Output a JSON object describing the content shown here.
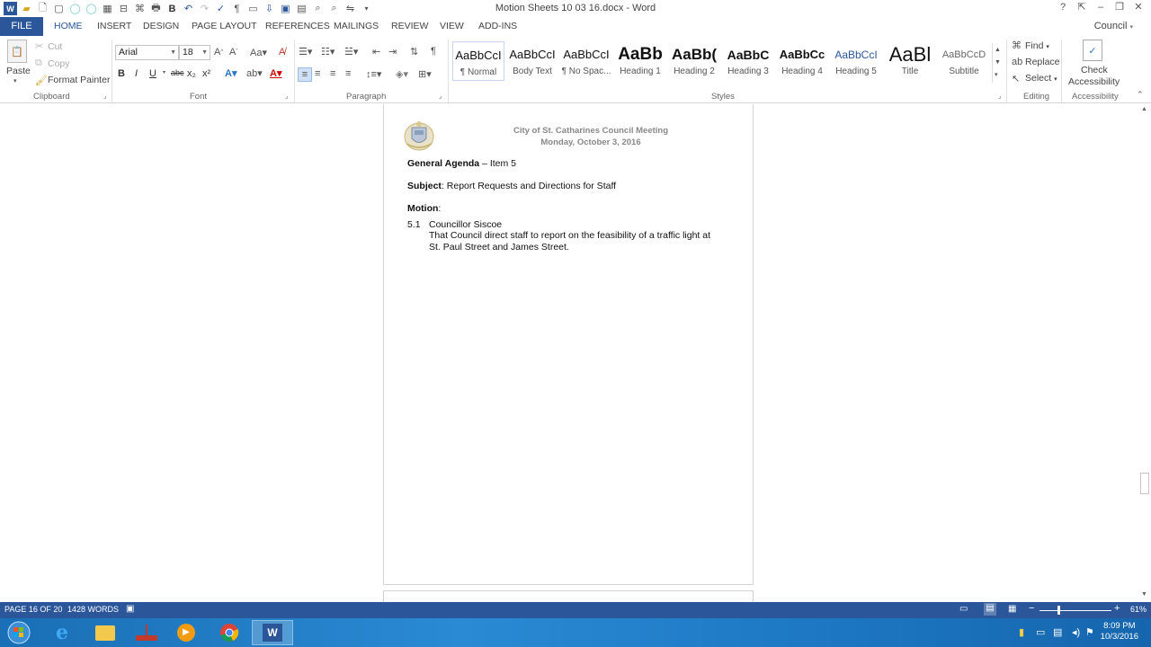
{
  "window": {
    "title": "Motion Sheets 10 03 16.docx - Word",
    "account": "Council",
    "controls": [
      "?",
      "□",
      "–",
      "❐",
      "✕"
    ]
  },
  "tabs": {
    "file": "FILE",
    "items": [
      "HOME",
      "INSERT",
      "DESIGN",
      "PAGE LAYOUT",
      "REFERENCES",
      "MAILINGS",
      "REVIEW",
      "VIEW",
      "ADD-INS"
    ],
    "active": "HOME"
  },
  "ribbon": {
    "clipboard": {
      "paste": "Paste",
      "cut": "Cut",
      "copy": "Copy",
      "format_painter": "Format Painter",
      "label": "Clipboard"
    },
    "font": {
      "family": "Arial",
      "size": "18",
      "label": "Font",
      "bold": "B",
      "italic": "I",
      "underline": "U",
      "strike": "abc",
      "subscript": "x₂",
      "superscript": "x²"
    },
    "paragraph": {
      "label": "Paragraph"
    },
    "styles": {
      "label": "Styles",
      "items": [
        {
          "sample": "AaBbCcI",
          "name": "¶ Normal"
        },
        {
          "sample": "AaBbCcI",
          "name": "Body Text"
        },
        {
          "sample": "AaBbCcI",
          "name": "¶ No Spac..."
        },
        {
          "sample": "AaBb",
          "name": "Heading 1"
        },
        {
          "sample": "AaBb(",
          "name": "Heading 2"
        },
        {
          "sample": "AaBbC",
          "name": "Heading 3"
        },
        {
          "sample": "AaBbCc",
          "name": "Heading 4"
        },
        {
          "sample": "AaBbCcI",
          "name": "Heading 5"
        },
        {
          "sample": "AaBl",
          "name": "Title"
        },
        {
          "sample": "AaBbCcD",
          "name": "Subtitle"
        }
      ]
    },
    "editing": {
      "find": "Find",
      "replace": "Replace",
      "select": "Select",
      "label": "Editing"
    },
    "accessibility": {
      "check_line1": "Check",
      "check_line2": "Accessibility",
      "label": "Accessibility"
    }
  },
  "document": {
    "header_line1": "City of St. Catharines Council Meeting",
    "header_line2": "Monday, October 3, 2016",
    "agenda_bold": "General Agenda",
    "agenda_rest": " – Item 5",
    "subject_bold": "Subject",
    "subject_rest": ": Report Requests and Directions for Staff",
    "motion_bold": "Motion",
    "motion_rest": ":",
    "item_number": "5.1",
    "item_title": "Councillor Siscoe",
    "item_text_line1": "That Council direct staff to report on the feasibility of a traffic light at",
    "item_text_line2": "St. Paul Street and James Street."
  },
  "status": {
    "page": "PAGE 16 OF 20",
    "words": "1428 WORDS",
    "zoom": "61%"
  },
  "taskbar": {
    "time": "8:09 PM",
    "date": "10/3/2016"
  }
}
